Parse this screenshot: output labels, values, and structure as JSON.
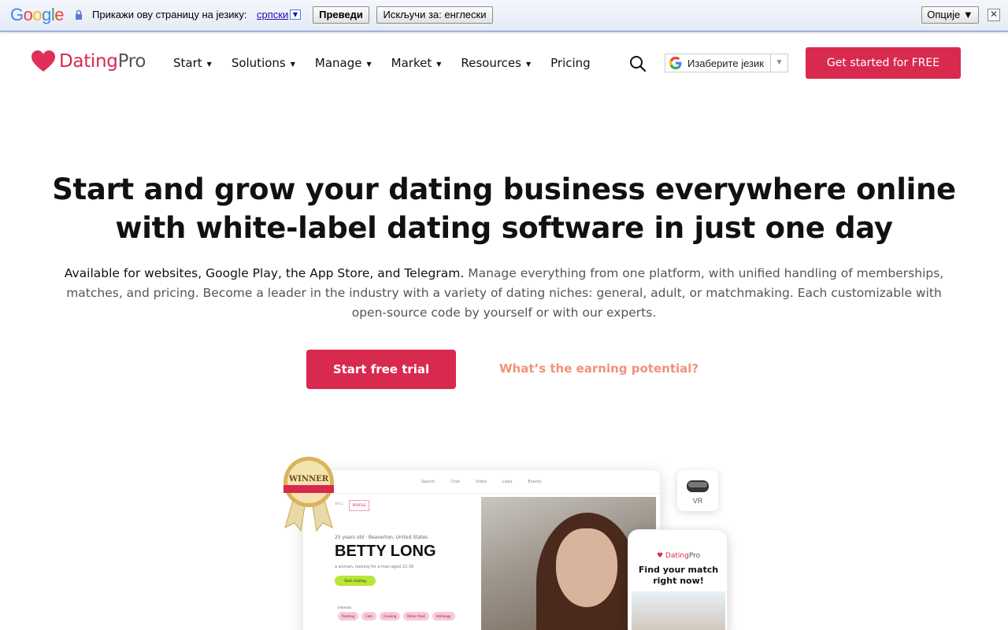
{
  "translate_bar": {
    "logo": "Google",
    "prompt": "Прикажи ову страницу на језику:",
    "language": "српски",
    "translate_button": "Преведи",
    "turn_off_button": "Искључи за: енглески",
    "options_button": "Опције ▼",
    "close": "✕"
  },
  "header": {
    "logo_dating": "Dating",
    "logo_pro": "Pro",
    "nav": [
      {
        "label": "Start",
        "has_dropdown": true
      },
      {
        "label": "Solutions",
        "has_dropdown": true
      },
      {
        "label": "Manage",
        "has_dropdown": true
      },
      {
        "label": "Market",
        "has_dropdown": true
      },
      {
        "label": "Resources",
        "has_dropdown": true
      },
      {
        "label": "Pricing",
        "has_dropdown": false
      }
    ],
    "language_select": "Изаберите језик",
    "cta": "Get started for FREE"
  },
  "hero": {
    "title": "Start and grow your dating business everywhere online with white-label dating software in just one day",
    "subtitle_strong": "Available for websites, Google Play, the App Store, and Telegram.",
    "subtitle_rest": " Manage everything from one platform, with unified handling of memberships, matches, and pricing. Become a leader in the industry with a variety of dating niches: general, adult, or matchmaking. Each customizable with open-source code by yourself or with our experts.",
    "primary_button": "Start free trial",
    "secondary_link": "What’s the earning potential?"
  },
  "mockup": {
    "profile_age": "25 years old · Beaverton, United States",
    "profile_name": "BETTY LONG",
    "profile_desc": "a woman, looking for a man aged 22-39",
    "start_chatting": "Start chatting",
    "interests_label": "Interests",
    "tags": [
      "Painting",
      "Cats",
      "Cooking",
      "Italian food",
      "Astrology"
    ],
    "nav_items": [
      "Search",
      "Chat",
      "Video",
      "Likes",
      "Events"
    ],
    "tab_wall": "WALL",
    "tab_profile": "PROFILE",
    "badge_text": "WINNER",
    "vr_label": "VR",
    "phone_logo_dating": "Dating",
    "phone_logo_pro": "Pro",
    "phone_heading": "Find your match right now!"
  },
  "colors": {
    "brand": "#d8294f",
    "accent_link": "#f0927a",
    "text": "#111111",
    "muted": "#555555"
  }
}
